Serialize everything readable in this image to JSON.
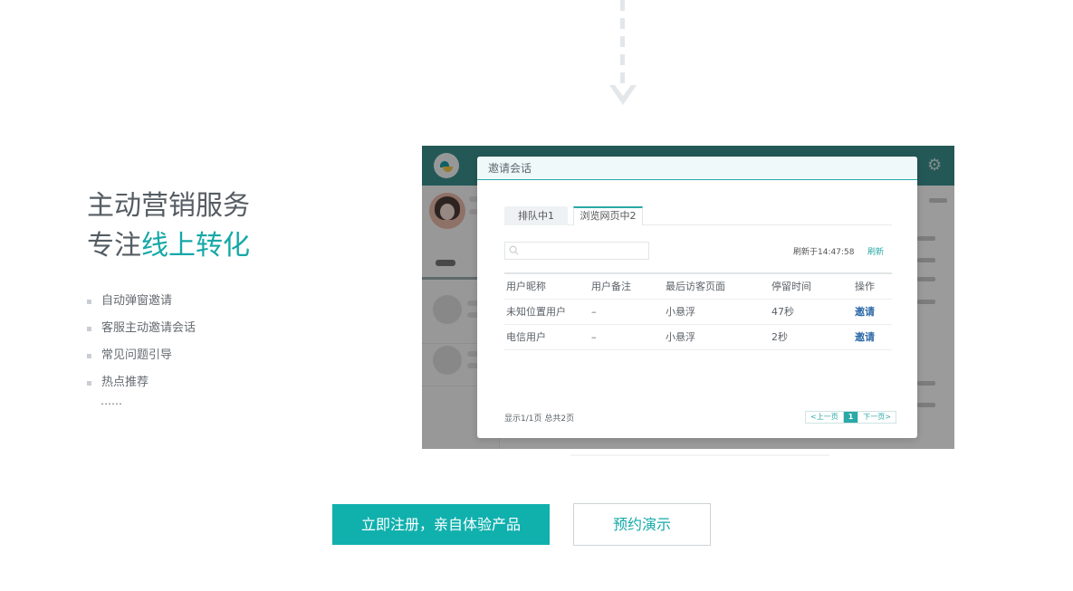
{
  "hero": {
    "title": "主动营销服务",
    "subtitle_prefix": "专注",
    "subtitle_accent": "线上转化",
    "features": [
      "自动弹窗邀请",
      "客服主动邀请会话",
      "常见问题引导",
      "热点推荐"
    ],
    "ellipsis": "……",
    "accent_color": "#16a8a8"
  },
  "dialog": {
    "title": "邀请会话",
    "tabs": [
      {
        "label": "排队中1",
        "active": false
      },
      {
        "label": "浏览网页中2",
        "active": true
      }
    ],
    "search": {
      "placeholder": ""
    },
    "refresh_time": "刷新于14:47:58",
    "refresh_label": "刷新",
    "columns": [
      "用户昵称",
      "用户备注",
      "最后访客页面",
      "停留时间",
      "操作"
    ],
    "rows": [
      {
        "nickname": "未知位置用户",
        "note": "–",
        "last_page": "小悬浮",
        "duration": "47秒",
        "action": "邀请"
      },
      {
        "nickname": "电信用户",
        "note": "–",
        "last_page": "小悬浮",
        "duration": "2秒",
        "action": "邀请"
      }
    ],
    "pager_info": "显示1/1页 总共2页",
    "pager": {
      "prev": "<上一页",
      "current": "1",
      "next": "下一页>"
    }
  },
  "app": {
    "header_color": "#3b8f8d",
    "icons": [
      "app-logo-icon",
      "gear-icon",
      "avatar"
    ]
  },
  "cta": {
    "primary_label": "立即注册，亲自体验产品",
    "secondary_label": "预约演示",
    "primary_color": "#10b0ad"
  }
}
